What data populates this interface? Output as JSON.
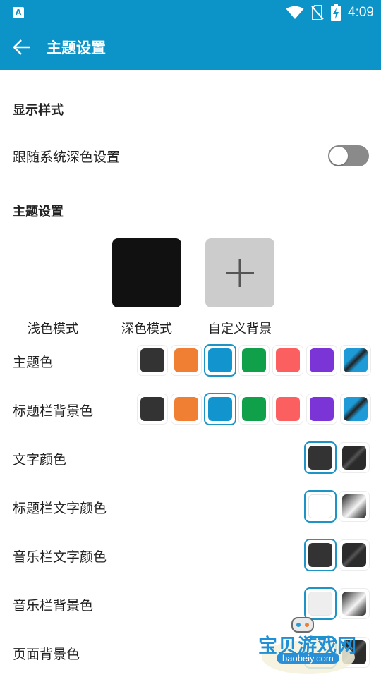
{
  "status_bar": {
    "time": "4:09",
    "icons": [
      "app-store-icon",
      "wifi-icon",
      "no-sim-icon",
      "battery-charging-icon"
    ]
  },
  "app_bar": {
    "title": "主题设置",
    "back_icon": "arrow-left-icon"
  },
  "display_section": {
    "heading": "显示样式",
    "follow_system_dark": {
      "label": "跟随系统深色设置",
      "enabled": false
    }
  },
  "theme_section": {
    "heading": "主题设置",
    "modes": [
      {
        "label": "浅色模式",
        "color": "#ffffff"
      },
      {
        "label": "深色模式",
        "color": "#111111"
      },
      {
        "label": "自定义背景",
        "color": "#cccccc",
        "icon": "plus-icon"
      }
    ]
  },
  "palette": [
    "#333333",
    "#f07f33",
    "#1294cf",
    "#11a04a",
    "#fc5f5f",
    "#7b35d6",
    "gradient-blue-black"
  ],
  "color_rows": [
    {
      "label": "主题色",
      "selected_index": 2
    },
    {
      "label": "标题栏背景色",
      "selected_index": 2
    }
  ],
  "pair_rows": [
    {
      "label": "文字颜色",
      "options": [
        "#333333",
        "gradient-dark"
      ],
      "selected_index": 0
    },
    {
      "label": "标题栏文字颜色",
      "options": [
        "#ffffff",
        "gradient-silver"
      ],
      "selected_index": 0
    },
    {
      "label": "音乐栏文字颜色",
      "options": [
        "#333333",
        "gradient-dark"
      ],
      "selected_index": 0
    },
    {
      "label": "音乐栏背景色",
      "options": [
        "#eeeeee",
        "gradient-silver"
      ],
      "selected_index": 0
    },
    {
      "label": "页面背景色",
      "options": [
        "#ffffff",
        "gradient-dark"
      ],
      "selected_index": 0
    }
  ],
  "watermark": {
    "text": "宝贝游戏网",
    "url": "baobeiy.com"
  }
}
